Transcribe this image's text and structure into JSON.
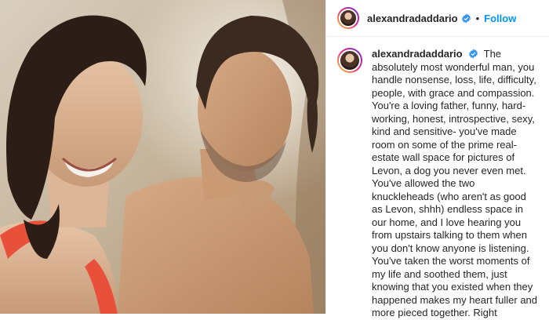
{
  "post": {
    "username": "alexandradaddario",
    "separator": "•",
    "follow_label": "Follow",
    "caption_text": "The absolutely most wonderful man, you handle nonsense, loss, life, difficulty, people, with grace and compassion. You're a loving father, funny, hard-working, honest, introspective, sexy, kind and sensitive- you've made room on some of the prime real-estate wall space for pictures of Levon, a dog you never even met. You've allowed the two knuckleheads (who aren't as good as Levon, shhh) endless space in our home, and I love hearing you from upstairs talking to them when you don't know anyone is listening. You've taken the worst moments of my life and soothed them, just knowing that you existed when they happened makes my heart fuller and more pieced together. Right"
  },
  "icons": {
    "verified": "verified-badge-icon"
  },
  "colors": {
    "follow": "#0095f6",
    "verified": "#3897f0",
    "text": "#262626"
  }
}
